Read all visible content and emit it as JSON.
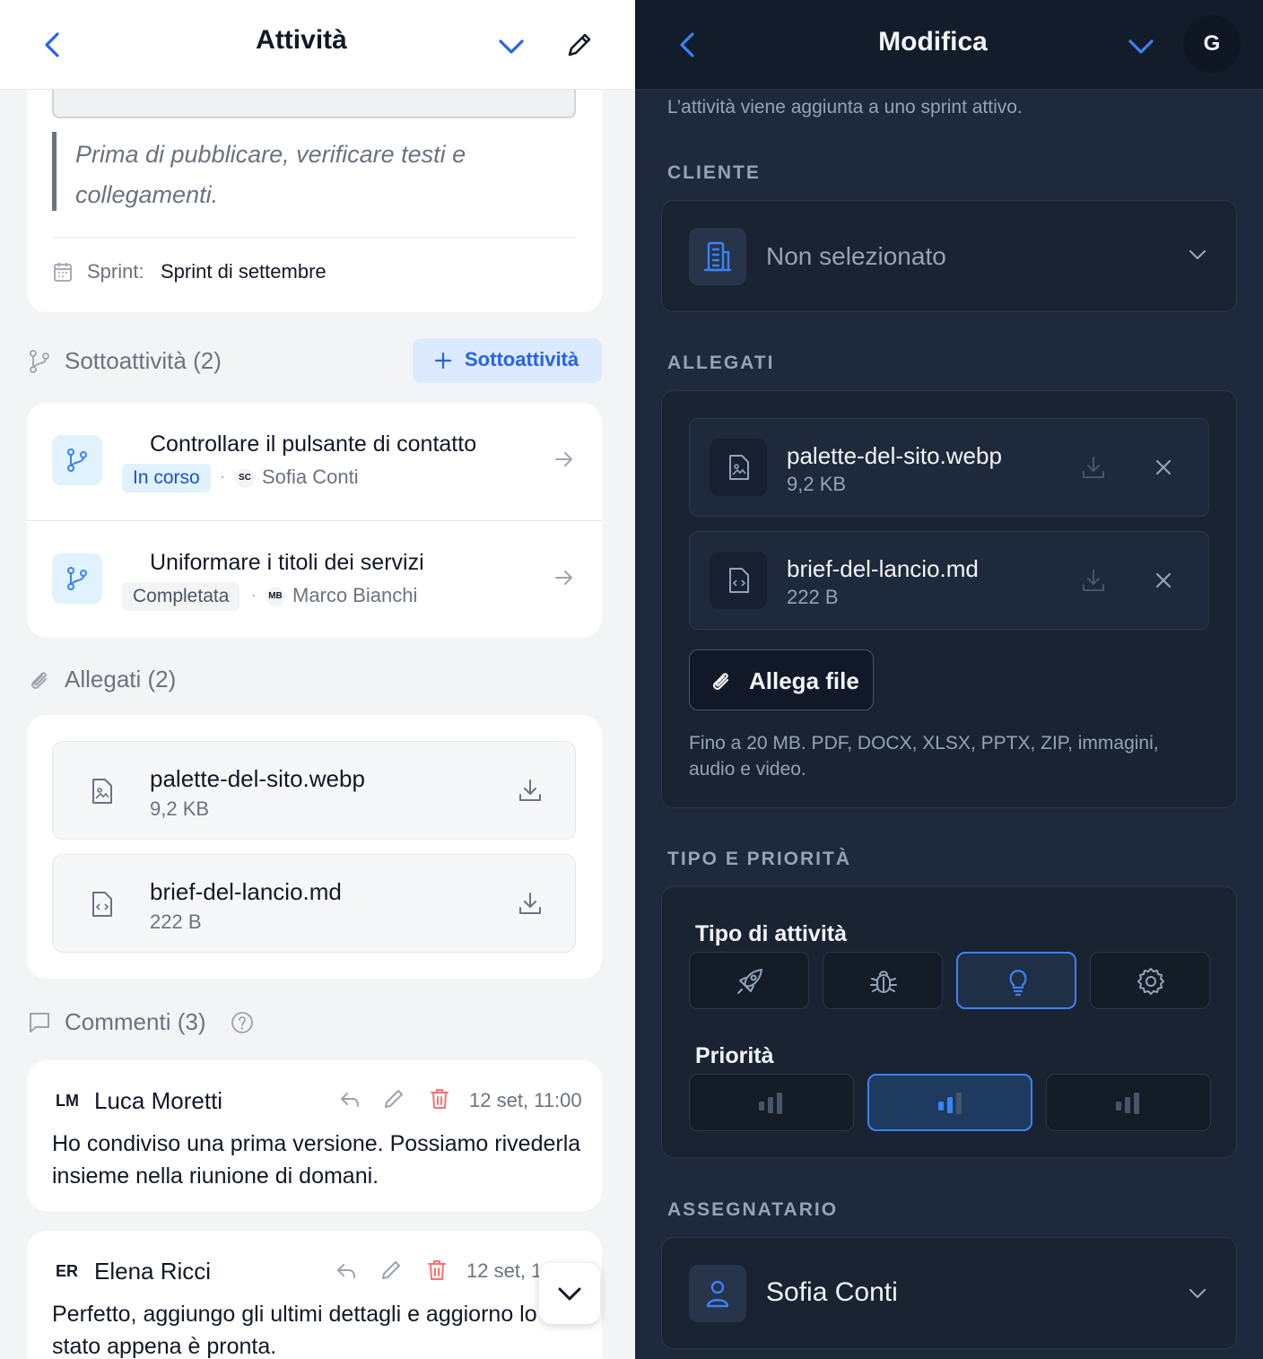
{
  "left": {
    "header": {
      "title": "Attività"
    },
    "note": "Prima di pubblicare, verificare testi e collegamenti.",
    "sprint": {
      "label": "Sprint:",
      "value": "Sprint di settembre"
    },
    "subtasks": {
      "title": "Sottoattività (2)",
      "add_label": "Sottoattività",
      "items": [
        {
          "title": "Controllare il pulsante di contatto",
          "status": "In corso",
          "initials": "SC",
          "assignee": "Sofia Conti"
        },
        {
          "title": "Uniformare i titoli dei servizi",
          "status": "Completata",
          "initials": "MB",
          "assignee": "Marco Bianchi"
        }
      ]
    },
    "attachments": {
      "title": "Allegati (2)",
      "items": [
        {
          "name": "palette-del-sito.webp",
          "size": "9,2 KB"
        },
        {
          "name": "brief-del-lancio.md",
          "size": "222 B"
        }
      ]
    },
    "comments": {
      "title": "Commenti (3)",
      "items": [
        {
          "initials": "LM",
          "author": "Luca Moretti",
          "date": "12 set, 11:00",
          "text": "Ho condiviso una prima versione. Possiamo rivederla insieme nella riunione di domani."
        },
        {
          "initials": "ER",
          "author": "Elena Ricci",
          "date": "12 set, 1",
          "text": "Perfetto, aggiungo gli ultimi dettagli e aggiorno lo stato appena è pronta."
        }
      ]
    }
  },
  "right": {
    "header": {
      "title": "Modifica",
      "avatar": "G"
    },
    "sprint_note": "L’attività viene aggiunta a uno sprint attivo.",
    "client": {
      "label": "CLIENTE",
      "value": "Non selezionato"
    },
    "attachments": {
      "label": "ALLEGATI",
      "items": [
        {
          "name": "palette-del-sito.webp",
          "size": "9,2 KB"
        },
        {
          "name": "brief-del-lancio.md",
          "size": "222 B"
        }
      ],
      "attach_label": "Allega file",
      "hint": "Fino a 20 MB. PDF, DOCX, XLSX, PPTX, ZIP, immagini, audio e video."
    },
    "type_priority": {
      "label": "TIPO E PRIORITÀ",
      "type_label": "Tipo di attività",
      "types": [
        "rocket-icon",
        "bug-icon",
        "lightbulb-icon",
        "gear-icon"
      ],
      "selected_type": "lightbulb-icon",
      "priority_label": "Priorità",
      "priorities": [
        "low",
        "medium",
        "high"
      ],
      "selected_priority": "medium"
    },
    "assignee": {
      "label": "ASSEGNATARIO",
      "value": "Sofia Conti"
    }
  },
  "colors": {
    "accent": "#3b82f6",
    "accent_dark": "#2563eb",
    "right_bg": "#1e293b",
    "left_bg": "#f3f4f6"
  }
}
